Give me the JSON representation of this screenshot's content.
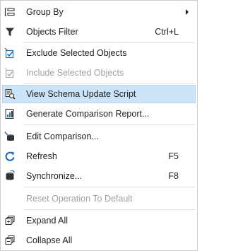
{
  "menu": {
    "group_by": {
      "label": "Group By",
      "icon": "group-by-icon"
    },
    "objects_filter": {
      "label": "Objects Filter",
      "shortcut": "Ctrl+L",
      "icon": "filter-icon"
    },
    "exclude_selected": {
      "label": "Exclude Selected Objects",
      "icon": "exclude-checkbox-icon"
    },
    "include_selected": {
      "label": "Include Selected Objects",
      "icon": "include-checkbox-icon"
    },
    "view_schema_update_script": {
      "label": "View Schema Update Script",
      "icon": "script-icon"
    },
    "generate_report": {
      "label": "Generate Comparison Report...",
      "icon": "report-icon"
    },
    "edit_comparison": {
      "label": "Edit Comparison...",
      "icon": "edit-comparison-icon"
    },
    "refresh": {
      "label": "Refresh",
      "shortcut": "F5",
      "icon": "refresh-icon"
    },
    "synchronize": {
      "label": "Synchronize...",
      "shortcut": "F8",
      "icon": "synchronize-icon"
    },
    "reset_operation": {
      "label": "Reset Operation To Default"
    },
    "expand_all": {
      "label": "Expand All",
      "icon": "expand-all-icon"
    },
    "collapse_all": {
      "label": "Collapse All",
      "icon": "collapse-all-icon"
    }
  },
  "colors": {
    "highlight_bg": "#cce4f7",
    "highlight_border": "#b5d3ee",
    "text": "#1e1e1e",
    "disabled_text": "#a0a0a0",
    "accent_blue": "#1f6fbf"
  }
}
